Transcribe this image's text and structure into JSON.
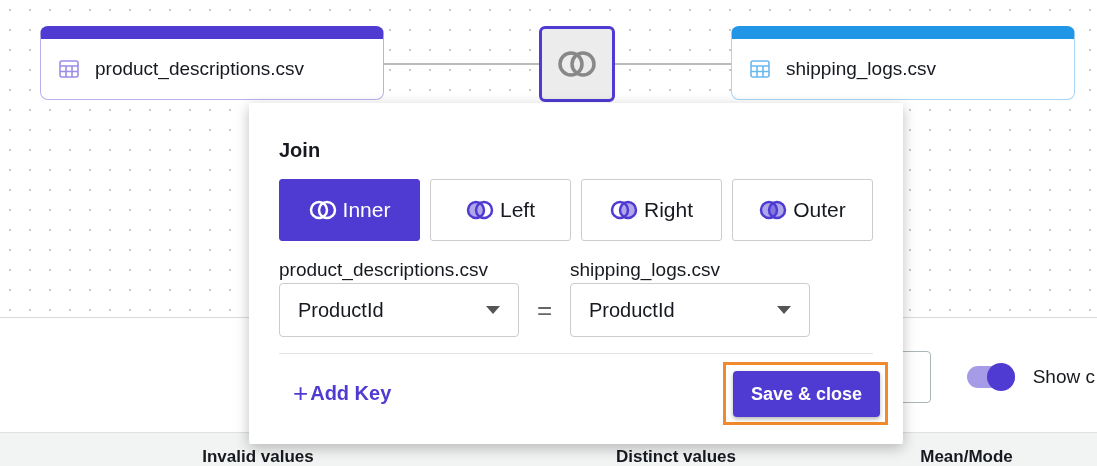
{
  "nodes": [
    {
      "label": "product_descriptions.csv",
      "color": "#4f3bd1"
    },
    {
      "label": "shipping_logs.csv",
      "color": "#2196e6"
    }
  ],
  "join_node": {
    "selected": true
  },
  "toolbar": {
    "toggle": {
      "on": true,
      "label": "Show c"
    }
  },
  "table": {
    "columns": [
      "Invalid values",
      "Distinct values",
      "Mean/Mode"
    ]
  },
  "join_popup": {
    "title": "Join",
    "join_types": [
      {
        "label": "Inner",
        "kind": "inner",
        "selected": true
      },
      {
        "label": "Left",
        "kind": "left",
        "selected": false
      },
      {
        "label": "Right",
        "kind": "right",
        "selected": false
      },
      {
        "label": "Outer",
        "kind": "outer",
        "selected": false
      }
    ],
    "keys": [
      {
        "left_label": "product_descriptions.csv",
        "left_value": "ProductId",
        "operator": "=",
        "right_label": "shipping_logs.csv",
        "right_value": "ProductId"
      }
    ],
    "add_key": {
      "icon": "+",
      "label": "Add Key"
    },
    "save_button": {
      "label": "Save & close",
      "highlighted": true
    }
  }
}
